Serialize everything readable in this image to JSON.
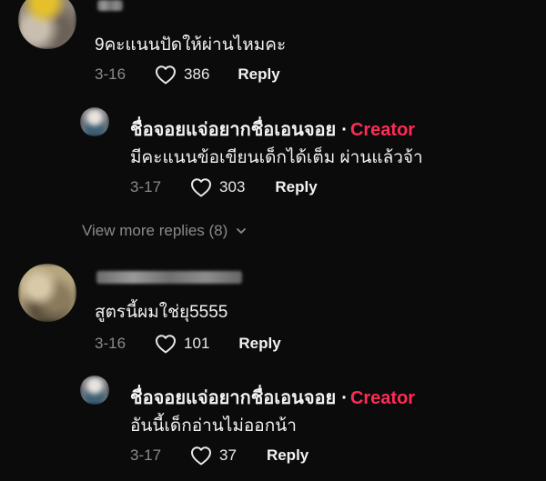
{
  "comments": [
    {
      "text": "9คะแนนปัดให้ผ่านไหมคะ",
      "date": "3-16",
      "likes": "386",
      "reply_label": "Reply",
      "reply": {
        "author": "ชื่อจอยแจ่อยากชื่อเอนจอย",
        "separator": "·",
        "badge": "Creator",
        "text": "มีคะแนนข้อเขียนเด็กได้เต็ม ผ่านแล้วจ้า",
        "date": "3-17",
        "likes": "303",
        "reply_label": "Reply"
      },
      "view_more": "View more replies (8)"
    },
    {
      "text": "สูตรนี้ผมใช่ยุ5555",
      "date": "3-16",
      "likes": "101",
      "reply_label": "Reply",
      "reply": {
        "author": "ชื่อจอยแจ่อยากชื่อเอนจอย",
        "separator": "·",
        "badge": "Creator",
        "text": "อันนี้เด็กอ่านไม่ออกน้า",
        "date": "3-17",
        "likes": "37",
        "reply_label": "Reply"
      }
    }
  ],
  "colors": {
    "background": "#0b0b0b",
    "creator_badge": "#fe2c55",
    "muted": "#8a8a8a"
  }
}
